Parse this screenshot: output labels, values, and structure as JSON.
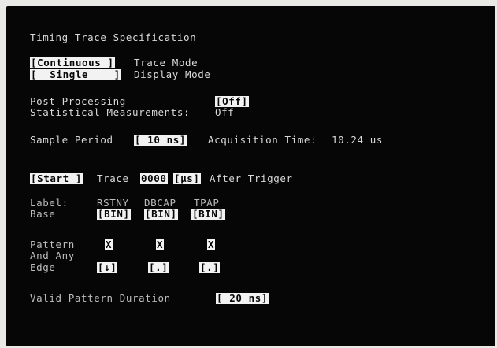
{
  "header": {
    "title": "Timing Trace Specification"
  },
  "trace_mode": {
    "value": "[Continuous ]",
    "label": "Trace Mode"
  },
  "display_mode": {
    "value": "[  Single    ]",
    "label": "Display Mode"
  },
  "post_processing": {
    "label": "Post Processing",
    "value": "[Off]"
  },
  "statistical": {
    "label": "Statistical Measurements:",
    "value": "Off"
  },
  "sample": {
    "label": "Sample Period",
    "value": "[ 10 ns]",
    "acq_label": "Acquisition Time:",
    "acq_value": "10.24 us"
  },
  "trace": {
    "start": "[Start ]",
    "word": "Trace",
    "count": "0000",
    "unit": "[µs]",
    "after": "After Trigger"
  },
  "labels": {
    "label_title": "Label:",
    "base_title": "Base",
    "columns": [
      {
        "name": "RSTNY",
        "base": "[BIN]",
        "pattern": "X",
        "edge": "[↓]"
      },
      {
        "name": "DBCAP",
        "base": "[BIN]",
        "pattern": "X",
        "edge": "[.]"
      },
      {
        "name": "TPAP",
        "base": "[BIN]",
        "pattern": "X",
        "edge": "[.]"
      }
    ]
  },
  "pattern": {
    "pattern_label": "Pattern",
    "and_label": "And Any",
    "edge_label": "Edge"
  },
  "duration": {
    "label": "Valid Pattern Duration",
    "value": "[ 20 ns]"
  }
}
